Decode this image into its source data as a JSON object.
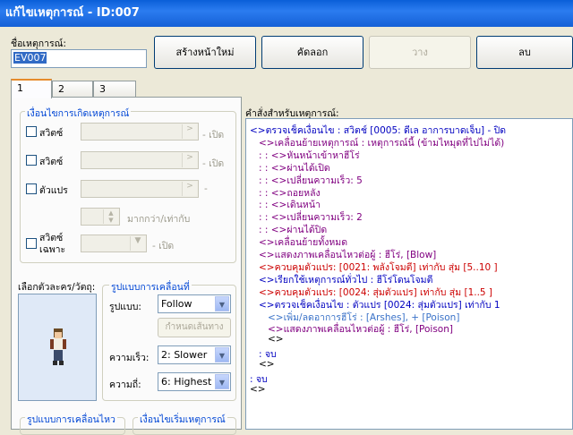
{
  "window": {
    "title": "แก้ไขเหตุการณ์ - ID:007"
  },
  "event_name": {
    "label": "ชื่อเหตุการณ์:",
    "value": "EV007"
  },
  "toolbar": {
    "new_page": "สร้างหน้าใหม่",
    "copy": "คัดลอก",
    "paste": "วาง",
    "delete": "ลบ"
  },
  "tabs": [
    "1",
    "2",
    "3"
  ],
  "conditions": {
    "title": "เงื่อนไขการเกิดเหตุการณ์",
    "switch1": "สวิตซ์",
    "switch1_suffix": "- เปิด",
    "switch2": "สวิตซ์",
    "switch2_suffix": "- เปิด",
    "variable": "ตัวแปร",
    "variable_suffix": "-",
    "compare_label": "มากกว่า/เท่ากับ",
    "self_switch_line1": "สวิตซ์",
    "self_switch_line2": "เฉพาะ",
    "self_switch_suffix": "- เปิด"
  },
  "graphic": {
    "title": "เลือกตัวละคร/วัตถุ:",
    "icon": "character-sprite"
  },
  "movement": {
    "title": "รูปแบบการเคลื่อนที่",
    "type_label": "รูปแบบ:",
    "type_value": "Follow",
    "route_button": "กำหนดเส้นทาง",
    "speed_label": "ความเร็ว:",
    "speed_value": "2: Slower",
    "freq_label": "ความถี่:",
    "freq_value": "6: Highest"
  },
  "bottom_groups": {
    "options": "รูปแบบการเคลื่อนไหว",
    "trigger": "เงื่อนไขเริ่มเหตุการณ์"
  },
  "commands": {
    "title": "คำสั่งสำหรับเหตุการณ์:",
    "lines": [
      {
        "text": "<>ตรวจเช็คเงื่อนไข : สวิตช์ [0005: ดีเล อาการบาดเจ็บ] - ปิด",
        "color": "#0000c0"
      },
      {
        "text": "<>เคลื่อนย้ายเหตุการณ์ : เหตุการณ์นี้ (ข้ามไหมุดที่ไปไม่ได้)",
        "color": "#800080"
      },
      {
        "text": ":                                                  : <>หันหน้าเข้าหาฮีโร่",
        "color": "#800080"
      },
      {
        "text": ":                                                  : <>ผ่านได้เปิด",
        "color": "#800080"
      },
      {
        "text": ":                                                  : <>เปลี่ยนความเร็ว: 5",
        "color": "#800080"
      },
      {
        "text": ":                                                  : <>ถอยหลัง",
        "color": "#800080"
      },
      {
        "text": ":                                                  : <>เดินหน้า",
        "color": "#800080"
      },
      {
        "text": ":                                                  : <>เปลี่ยนความเร็ว: 2",
        "color": "#800080"
      },
      {
        "text": ":                                                  : <>ผ่านได้ปิด",
        "color": "#800080"
      },
      {
        "text": "<>เคลื่อนย้ายทั้งหมด",
        "color": "#800080"
      },
      {
        "text": "<>แสดงภาพเคลื่อนไหวต่อผู้ : ฮีโร่, [Blow]",
        "color": "#800080"
      },
      {
        "text": "<>ควบคุมตัวแปร: [0021: พลังโจมตี] เท่ากับ สุ่ม [5..10 ]",
        "color": "#cc0000"
      },
      {
        "text": "<>เรียกใช้เหตุการณ์ทั่วไป : ฮีโร่โดนโจมตี",
        "color": "#0000c0"
      },
      {
        "text": "<>ควบคุมตัวแปร: [0024: สุ่มตัวแปร] เท่ากับ สุ่ม [1..5 ]",
        "color": "#cc0000"
      },
      {
        "text": "<>ตรวจเช็คเงื่อนไข : ตัวแปร [0024: สุ่มตัวแปร] เท่ากับ 1",
        "color": "#0000c0"
      },
      {
        "text": "<>เพิ่ม/ลดอาการฮีโร่ : [Arshes], + [Poison]",
        "color": "#3a72c8"
      },
      {
        "text": "<>แสดงภาพเคลื่อนไหวต่อผู้ : ฮีโร่, [Poison]",
        "color": "#800080"
      },
      {
        "text": "<>",
        "color": "#000000"
      },
      {
        "text": ":  จบ",
        "color": "#0000c0"
      },
      {
        "text": "<>",
        "color": "#000000"
      },
      {
        "text": ":  จบ",
        "color": "#0000c0"
      },
      {
        "text": "<>",
        "color": "#000000"
      }
    ]
  }
}
